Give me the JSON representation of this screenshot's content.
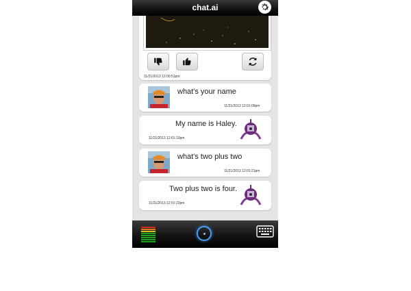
{
  "app": {
    "title": "chat.ai"
  },
  "image_card": {
    "timestamp": "11/21/2013 12:00:51pm"
  },
  "messages": [
    {
      "sender": "user",
      "text": "what's your name",
      "timestamp": "11/21/2013 12:01:09pm"
    },
    {
      "sender": "bot",
      "text": "My name is Haley.",
      "timestamp": "11/21/2013 12:01:10pm"
    },
    {
      "sender": "user",
      "text": "what's two plus two",
      "timestamp": "11/21/2013 12:01:21pm"
    },
    {
      "sender": "bot",
      "text": "Two plus two is four.",
      "timestamp": "11/21/2013 12:01:22pm"
    }
  ],
  "icons": {
    "settings": "gear-icon",
    "dislike": "thumbs-down-icon",
    "like": "thumbs-up-icon",
    "refresh": "refresh-icon",
    "mic": "microphone-icon",
    "keyboard": "keyboard-icon"
  },
  "colors": {
    "mic_accent": "#4a9df0",
    "meter_green": "#1fa31f",
    "meter_red": "#d22a1f"
  }
}
